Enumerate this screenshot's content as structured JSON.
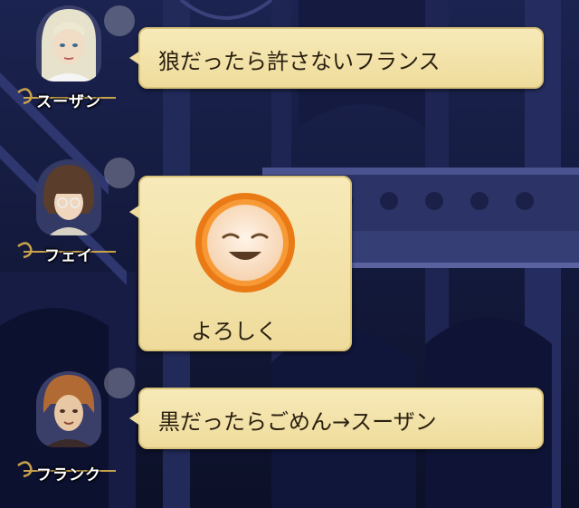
{
  "messages": [
    {
      "speaker": "スーザン",
      "text": "狼だったら許さないフランス",
      "avatar": "susan-portrait"
    },
    {
      "speaker": "フェイ",
      "text": "よろしく",
      "stamp": "smiling-face-stamp",
      "avatar": "fei-portrait"
    },
    {
      "speaker": "フランク",
      "text": "黒だったらごめん→スーザン",
      "avatar": "frank-portrait"
    }
  ],
  "colors": {
    "bubble": "#f3e3aa",
    "bubble_border": "#d9c27a",
    "background": "#141a3c",
    "stamp_ring": "#f08a1c"
  }
}
